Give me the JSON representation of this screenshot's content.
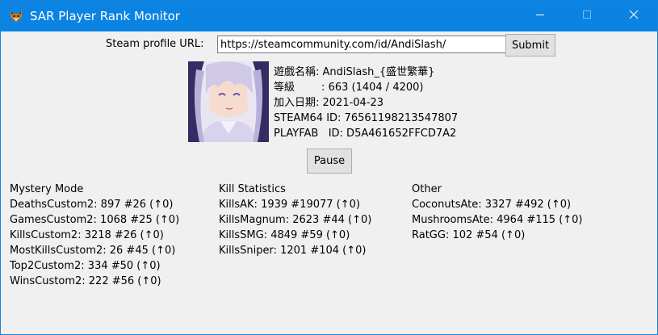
{
  "window": {
    "title": "SAR Player Rank Monitor",
    "app_icon": "fox-head-icon",
    "controls": [
      "minimize-icon",
      "maximize-icon",
      "close-icon"
    ]
  },
  "form": {
    "url_label": "Steam profile URL:",
    "url_value": "https://steamcommunity.com/id/AndiSlash/",
    "submit_label": "Submit"
  },
  "profile": {
    "avatar": "anime-girl-avatar",
    "name_line": "遊戲名稱: AndiSlash_{盛世繁華}",
    "level_line": "等級        : 663 (1404 / 4200)",
    "joined_line": "加入日期: 2021-04-23",
    "steam64_line": "STEAM64 ID: 76561198213547807",
    "playfab_line": "PLAYFAB   ID: D5A461652FFCD7A2"
  },
  "pause_label": "Pause",
  "sections": [
    {
      "title": "Mystery Mode",
      "items": [
        "DeathsCustom2: 897 #26 (↑0)",
        "GamesCustom2: 1068 #25 (↑0)",
        "KillsCustom2: 3218 #26 (↑0)",
        "MostKillsCustom2: 26 #45 (↑0)",
        "Top2Custom2: 334 #50 (↑0)",
        "WinsCustom2: 222 #56 (↑0)"
      ]
    },
    {
      "title": "Kill Statistics",
      "items": [
        "KillsAK: 1939 #19077 (↑0)",
        "KillsMagnum: 2623 #44 (↑0)",
        "KillsSMG: 4849 #59 (↑0)",
        "KillsSniper: 1201 #104 (↑0)"
      ]
    },
    {
      "title": "Other",
      "items": [
        "CoconutsAte: 3327 #492 (↑0)",
        "MushroomsAte: 4964 #115 (↑0)",
        "RatGG: 102 #54 (↑0)"
      ]
    }
  ],
  "colors": {
    "titlebar": "#0a83e3",
    "window_bg": "#f0f0f0",
    "button_bg": "#e1e1e1"
  }
}
